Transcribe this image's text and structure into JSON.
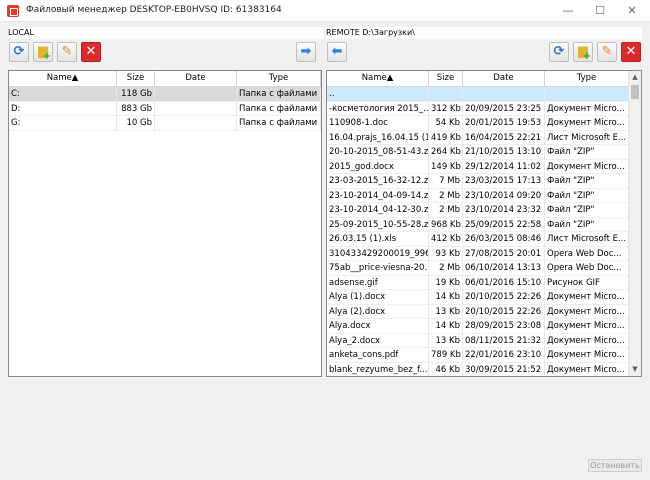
{
  "window": {
    "title": "Файловый менеджер DESKTOP-EB0HVSQ ID: 61383164",
    "min_glyph": "—",
    "max_glyph": "☐",
    "close_glyph": "✕"
  },
  "local": {
    "label": "LOCAL",
    "columns": [
      "Name▲",
      "Size",
      "Date",
      "Type"
    ],
    "rows": [
      {
        "name": "C:",
        "size": "118 Gb",
        "date": "",
        "type": "Папка с файлами"
      },
      {
        "name": "D:",
        "size": "883 Gb",
        "date": "",
        "type": "Папка с файлами"
      },
      {
        "name": "G:",
        "size": "10 Gb",
        "date": "",
        "type": "Папка с файлами"
      }
    ]
  },
  "remote": {
    "label": "REMOTE D:\\Загрузки\\",
    "columns": [
      "Name▲",
      "Size",
      "Date",
      "Type"
    ],
    "rows": [
      {
        "name": "..",
        "size": "",
        "date": "",
        "type": ""
      },
      {
        "name": "-косметология 2015_...",
        "size": "312 Kb",
        "date": "20/09/2015  23:25",
        "type": "Документ Micro..."
      },
      {
        "name": "110908-1.doc",
        "size": "54 Kb",
        "date": "20/01/2015  19:53",
        "type": "Документ Micro..."
      },
      {
        "name": "16.04.prajs_16.04.15 (1)...",
        "size": "419 Kb",
        "date": "16/04/2015  22:21",
        "type": "Лист Microsoft E..."
      },
      {
        "name": "20-10-2015_08-51-43.zip",
        "size": "264 Kb",
        "date": "21/10/2015  13:10",
        "type": "Файл \"ZIP\""
      },
      {
        "name": "2015_god.docx",
        "size": "149 Kb",
        "date": "29/12/2014  11:02",
        "type": "Документ Micro..."
      },
      {
        "name": "23-03-2015_16-32-12.zip",
        "size": "7 Mb",
        "date": "23/03/2015  17:13",
        "type": "Файл \"ZIP\""
      },
      {
        "name": "23-10-2014_04-09-14.zip",
        "size": "2 Mb",
        "date": "23/10/2014  09:20",
        "type": "Файл \"ZIP\""
      },
      {
        "name": "23-10-2014_04-12-30.zip",
        "size": "2 Mb",
        "date": "23/10/2014  23:32",
        "type": "Файл \"ZIP\""
      },
      {
        "name": "25-09-2015_10-55-28.zip",
        "size": "968 Kb",
        "date": "25/09/2015  22:58",
        "type": "Файл \"ZIP\""
      },
      {
        "name": "26.03.15 (1).xls",
        "size": "412 Kb",
        "date": "26/03/2015  08:46",
        "type": "Лист Microsoft E..."
      },
      {
        "name": "310433429200019_996...",
        "size": "93 Kb",
        "date": "27/08/2015  20:01",
        "type": "Opera Web Doc..."
      },
      {
        "name": "75ab__price-viesna-20...",
        "size": "2 Mb",
        "date": "06/10/2014  13:13",
        "type": "Opera Web Doc..."
      },
      {
        "name": "adsense.gif",
        "size": "19 Kb",
        "date": "06/01/2016  15:10",
        "type": "Рисунок GIF"
      },
      {
        "name": "Alya (1).docx",
        "size": "14 Kb",
        "date": "20/10/2015  22:26",
        "type": "Документ Micro..."
      },
      {
        "name": "Alya (2).docx",
        "size": "13 Kb",
        "date": "20/10/2015  22:26",
        "type": "Документ Micro..."
      },
      {
        "name": "Alya.docx",
        "size": "14 Kb",
        "date": "28/09/2015  23:08",
        "type": "Документ Micro..."
      },
      {
        "name": "Alya_2.docx",
        "size": "13 Kb",
        "date": "08/11/2015  21:32",
        "type": "Документ Micro..."
      },
      {
        "name": "anketa_cons.pdf",
        "size": "789 Kb",
        "date": "22/01/2016  23:10",
        "type": "Документ Micro..."
      },
      {
        "name": "blank_rezyume_bez_f...",
        "size": "46 Kb",
        "date": "30/09/2015  21:52",
        "type": "Документ Micro..."
      }
    ]
  },
  "icons": {
    "refresh": "refresh-icon",
    "new_folder": "new-folder-icon",
    "rename": "pencil-icon",
    "delete": "delete-icon",
    "copy_right": "arrow-right-icon",
    "copy_left": "arrow-left-icon"
  },
  "colors": {
    "delete_red": "#d92b2b",
    "arrow_blue": "#2d7fe0",
    "selection_gray": "#dadada",
    "highlight_blue": "#cce8ff"
  },
  "footer": {
    "stop_label": "Остановить"
  }
}
